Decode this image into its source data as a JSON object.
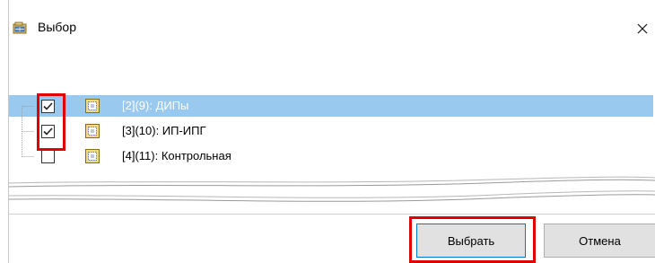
{
  "window": {
    "title": "Выбор",
    "icon": "folder-table-icon",
    "close_glyph": "×"
  },
  "tree": {
    "items": [
      {
        "label": "[2](9): ДИПы",
        "checked": true,
        "selected": true,
        "icon": "object-node-icon"
      },
      {
        "label": "[3](10): ИП-ИПГ",
        "checked": true,
        "selected": false,
        "icon": "object-node-icon"
      },
      {
        "label": "[4](11): Контрольная",
        "checked": false,
        "selected": false,
        "icon": "object-node-icon"
      }
    ]
  },
  "buttons": {
    "ok_label": "Выбрать",
    "cancel_label": "Отмена"
  },
  "colors": {
    "selection": "#99c9ef",
    "highlight_box": "#e00000",
    "button_face": "#e1e1e1",
    "default_button_border": "#0078d7"
  }
}
